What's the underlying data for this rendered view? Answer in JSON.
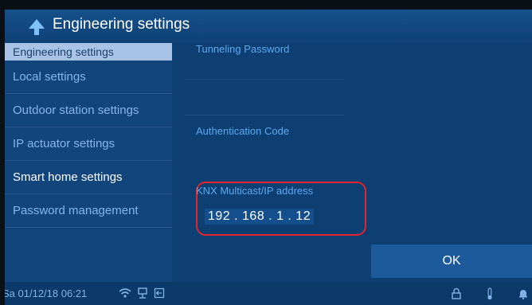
{
  "title": "Engineering settings",
  "icons": {
    "back": "back-arrow-icon",
    "wifi": "wifi-icon",
    "network": "network-icon",
    "exit": "exit-icon",
    "lock": "lock-icon",
    "thermometer": "thermometer-icon",
    "bell": "bell-icon"
  },
  "sidebar": {
    "header": "Engineering settings",
    "items": [
      {
        "label": "Local settings",
        "active": false
      },
      {
        "label": "Outdoor station settings",
        "active": false
      },
      {
        "label": "IP actuator settings",
        "active": false
      },
      {
        "label": "Smart home settings",
        "active": true
      },
      {
        "label": "Password management",
        "active": false
      }
    ]
  },
  "content": {
    "tunneling_password_label": "Tunneling Password",
    "auth_code_label": "Authentication Code",
    "knx_label": "KNX Multicast/IP address",
    "knx_value": "192 . 168 . 1 . 12"
  },
  "ok_label": "OK",
  "status": {
    "datetime": "Sa 01/12/18  06:21"
  },
  "colors": {
    "accent": "#5fa8ee",
    "highlight": "#e0262c",
    "background": "#0e3f73"
  }
}
